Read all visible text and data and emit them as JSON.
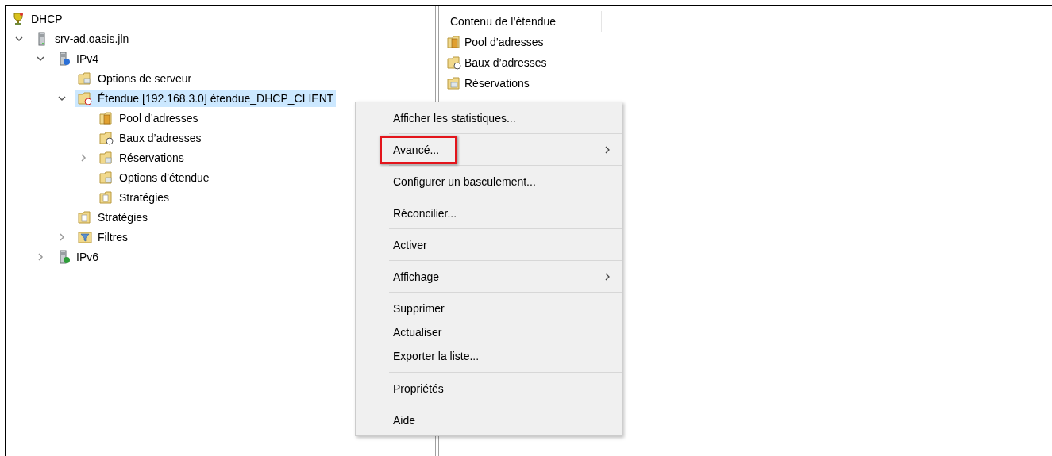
{
  "tree": [
    {
      "label": "DHCP",
      "kind": "root",
      "selected": false,
      "children": [
        {
          "label": "srv-ad.oasis.jln",
          "kind": "server",
          "selected": false,
          "expanded": true,
          "children": [
            {
              "label": "IPv4",
              "kind": "ipv4",
              "selected": false,
              "expanded": true,
              "children": [
                {
                  "label": "Options de serveur",
                  "kind": "options",
                  "selected": false
                },
                {
                  "label": "Étendue [192.168.3.0] étendue_DHCP_CLIENT",
                  "kind": "scope",
                  "selected": true,
                  "expanded": true,
                  "children": [
                    {
                      "label": "Pool d’adresses",
                      "kind": "pool",
                      "selected": false
                    },
                    {
                      "label": "Baux d’adresses",
                      "kind": "leases",
                      "selected": false
                    },
                    {
                      "label": "Réservations",
                      "kind": "reservations",
                      "selected": false,
                      "expanded": false
                    },
                    {
                      "label": "Options d’étendue",
                      "kind": "options",
                      "selected": false
                    },
                    {
                      "label": "Stratégies",
                      "kind": "policies",
                      "selected": false
                    }
                  ]
                },
                {
                  "label": "Stratégies",
                  "kind": "policies",
                  "selected": false
                },
                {
                  "label": "Filtres",
                  "kind": "filters",
                  "selected": false,
                  "expanded": false
                }
              ]
            },
            {
              "label": "IPv6",
              "kind": "ipv6",
              "selected": false,
              "expanded": false
            }
          ]
        }
      ]
    }
  ],
  "content": {
    "column": "Contenu de l’étendue",
    "items": [
      {
        "label": "Pool d’adresses",
        "kind": "pool"
      },
      {
        "label": "Baux d’adresses",
        "kind": "leases"
      },
      {
        "label": "Réservations",
        "kind": "reservations"
      }
    ]
  },
  "context_menu": [
    [
      {
        "label": "Afficher les statistiques...",
        "submenu": false,
        "highlighted": false
      }
    ],
    [
      {
        "label": "Avancé...",
        "submenu": true,
        "highlighted": true
      }
    ],
    [
      {
        "label": "Configurer un basculement...",
        "submenu": false,
        "highlighted": false
      }
    ],
    [
      {
        "label": "Réconcilier...",
        "submenu": false,
        "highlighted": false
      }
    ],
    [
      {
        "label": "Activer",
        "submenu": false,
        "highlighted": false
      }
    ],
    [
      {
        "label": "Affichage",
        "submenu": true,
        "highlighted": false
      }
    ],
    [
      {
        "label": "Supprimer",
        "submenu": false,
        "highlighted": false
      },
      {
        "label": "Actualiser",
        "submenu": false,
        "highlighted": false
      },
      {
        "label": "Exporter la liste...",
        "submenu": false,
        "highlighted": false
      }
    ],
    [
      {
        "label": "Propriétés",
        "submenu": false,
        "highlighted": false
      }
    ],
    [
      {
        "label": "Aide",
        "submenu": false,
        "highlighted": false
      }
    ]
  ]
}
